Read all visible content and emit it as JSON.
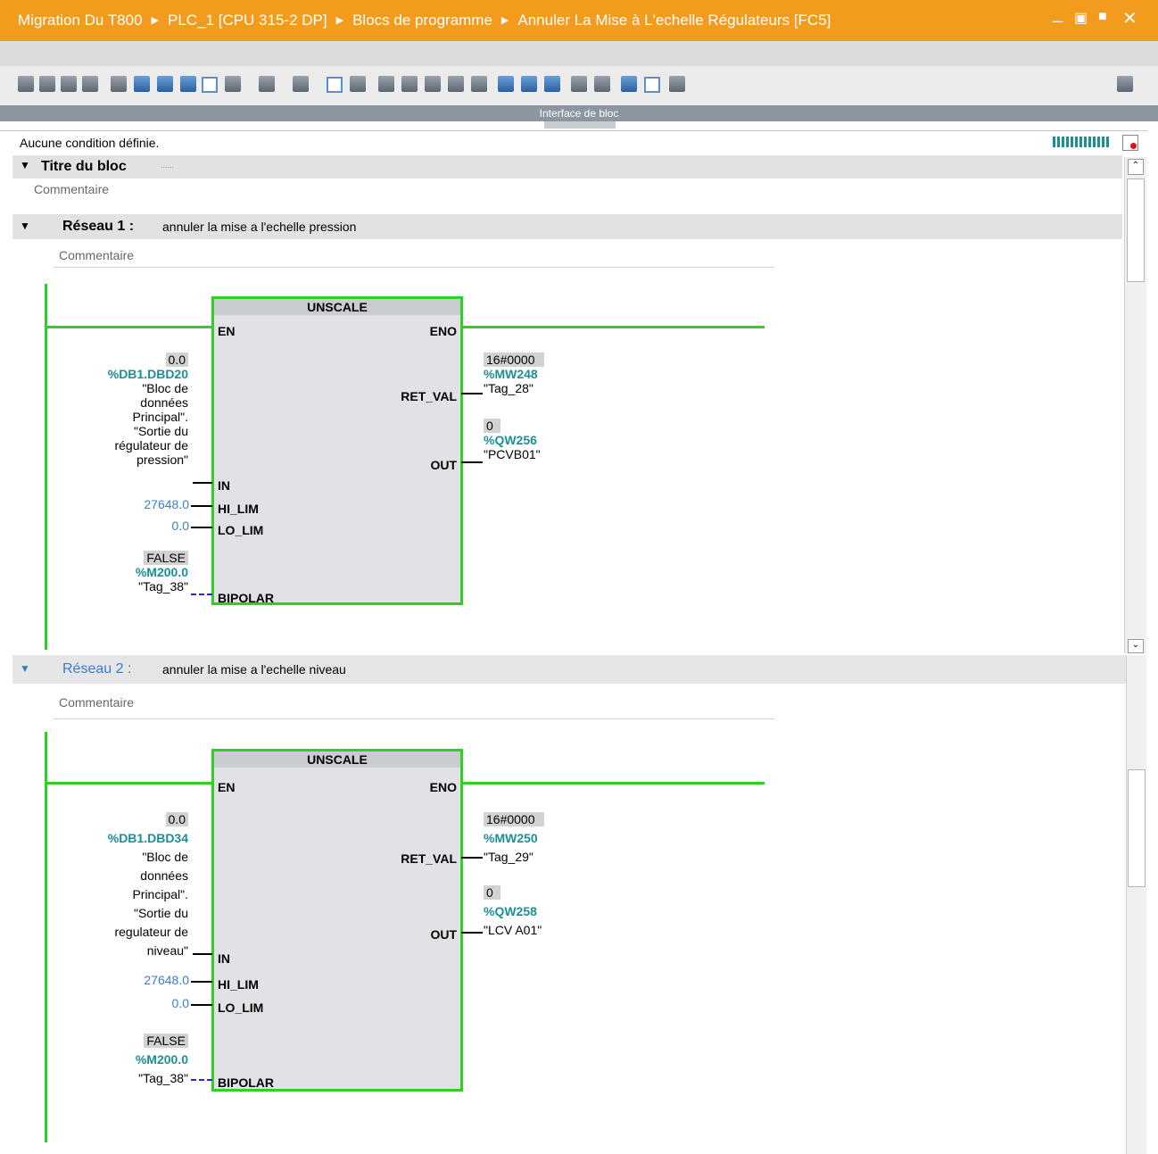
{
  "titlebar": {
    "path": [
      "Migration Du T800",
      "PLC_1 [CPU 315-2 DP]",
      "Blocs de programme",
      "Annuler La Mise à L'echelle Régulateurs [FC5]"
    ],
    "sep": "▶",
    "min": "_",
    "restore": "▣",
    "max": "■",
    "close": "✕"
  },
  "interface_label": "Interface de bloc",
  "condition_text": "Aucune condition définie.",
  "block": {
    "title": "Titre du bloc",
    "title_suffix": "......",
    "comment_placeholder": "Commentaire"
  },
  "networks": [
    {
      "label": "Réseau 1 :",
      "title": "annuler la mise a l'echelle pression",
      "comment_placeholder": "Commentaire",
      "box_name": "UNSCALE",
      "pins": {
        "en": "EN",
        "eno": "ENO",
        "ret_val": "RET_VAL",
        "out": "OUT",
        "in": "IN",
        "hi_lim": "HI_LIM",
        "lo_lim": "LO_LIM",
        "bipolar": "BIPOLAR"
      },
      "in_value": "0.0",
      "in_address": "%DB1.DBD20",
      "in_symbol": [
        "\"Bloc de",
        "données",
        "Principal\".",
        "\"Sortie du",
        "régulateur de",
        "pression\""
      ],
      "hi_lim": "27648.0",
      "lo_lim": "0.0",
      "bipolar_value": "FALSE",
      "bipolar_address": "%M200.0",
      "bipolar_symbol": "\"Tag_38\"",
      "ret_val_value": "16#0000",
      "ret_val_address": "%MW248",
      "ret_val_symbol": "\"Tag_28\"",
      "out_value": "0",
      "out_address": "%QW256",
      "out_symbol": "\"PCVB01\""
    },
    {
      "label": "Réseau 2 :",
      "title": "annuler la mise a l'echelle niveau",
      "comment_placeholder": "Commentaire",
      "box_name": "UNSCALE",
      "pins": {
        "en": "EN",
        "eno": "ENO",
        "ret_val": "RET_VAL",
        "out": "OUT",
        "in": "IN",
        "hi_lim": "HI_LIM",
        "lo_lim": "LO_LIM",
        "bipolar": "BIPOLAR"
      },
      "in_value": "0.0",
      "in_address": "%DB1.DBD34",
      "in_symbol": [
        "\"Bloc de",
        "données",
        "Principal\".",
        "\"Sortie du",
        "regulateur de",
        "niveau\""
      ],
      "hi_lim": "27648.0",
      "lo_lim": "0.0",
      "bipolar_value": "FALSE",
      "bipolar_address": "%M200.0",
      "bipolar_symbol": "\"Tag_38\"",
      "ret_val_value": "16#0000",
      "ret_val_address": "%MW250",
      "ret_val_symbol": "\"Tag_29\"",
      "out_value": "0",
      "out_address": "%QW258",
      "out_symbol": "\"LCV A01\""
    }
  ],
  "colors": {
    "titlebar": "#f39b1c",
    "wire": "#2fd024",
    "address": "#1a8f95",
    "constant": "#3e7fc4"
  }
}
